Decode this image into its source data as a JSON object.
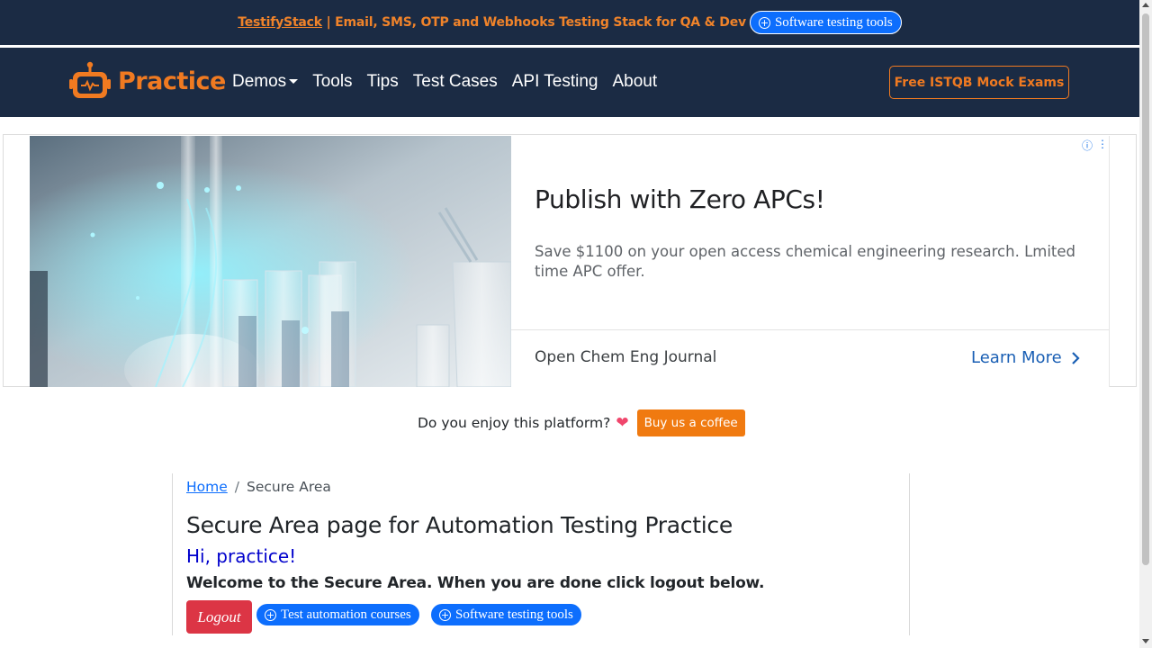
{
  "promo": {
    "link_text": "TestifyStack",
    "text": "| Email, SMS, OTP and Webhooks Testing Stack for QA & Dev",
    "pill_label": "Software testing tools"
  },
  "nav": {
    "brand": "Practice",
    "links": [
      "Demos",
      "Tools",
      "Tips",
      "Test Cases",
      "API Testing",
      "About"
    ],
    "cta": "Free ISTQB Mock Exams"
  },
  "ad": {
    "title": "Publish with Zero APCs!",
    "description": "Save $1100 on your open access chemical engineering research. Lmited time APC offer.",
    "source": "Open Chem Eng Journal",
    "cta": "Learn More"
  },
  "coffee": {
    "text": "Do you enjoy this platform?",
    "button": "Buy us a coffee"
  },
  "breadcrumb": {
    "home": "Home",
    "separator": "/",
    "current": "Secure Area"
  },
  "main": {
    "title": "Secure Area page for Automation Testing Practice",
    "greeting": "Hi, practice!",
    "welcome": "Welcome to the Secure Area. When you are done click logout below.",
    "logout": "Logout",
    "pills": [
      "Test automation courses",
      "Software testing tools"
    ]
  },
  "colors": {
    "navy": "#1b2b44",
    "orange": "#f07a21",
    "primary": "#0d6efd",
    "danger": "#dc3545"
  }
}
